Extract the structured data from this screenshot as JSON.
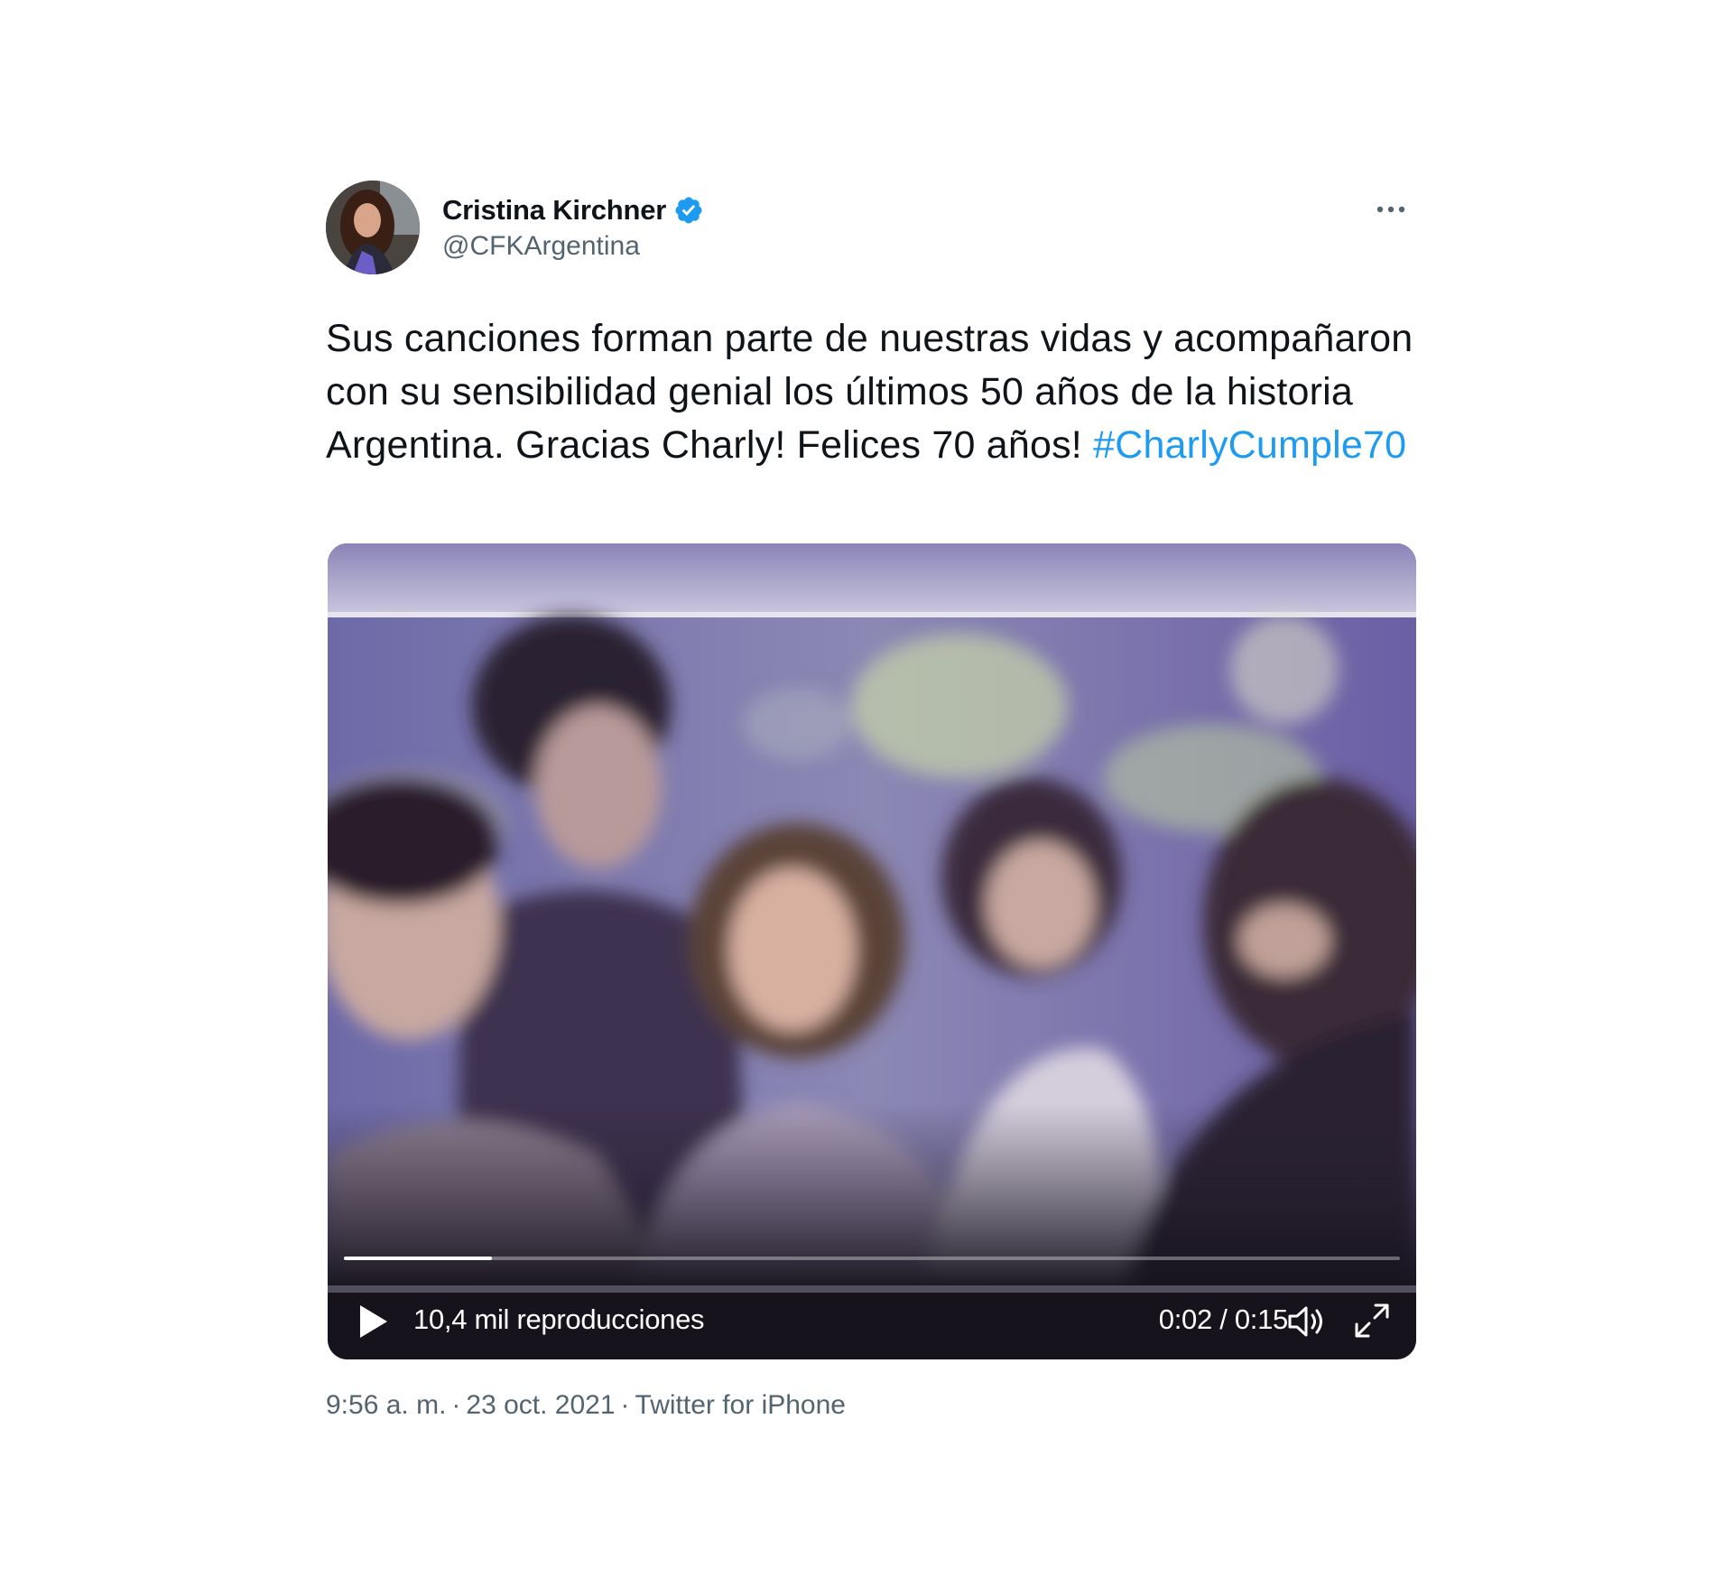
{
  "tweet": {
    "author": {
      "display_name": "Cristina Kirchner",
      "handle": "@CFKArgentina",
      "verified": true
    },
    "text": "Sus canciones forman parte de nuestras vidas y acompañaron con su sensibilidad genial los últimos 50 años de la historia Argentina. Gracias Charly! Felices 70 años! ",
    "hashtag": "#CharlyCumple70",
    "video": {
      "views": "10,4 mil reproducciones",
      "time": "0:02 / 0:15",
      "progress_fraction": 0.14
    },
    "meta": {
      "time": "9:56 a. m.",
      "separator": "·",
      "date": "23 oct. 2021",
      "source": "Twitter for iPhone"
    }
  },
  "colors": {
    "link": "#1d9bf0",
    "secondary_text": "#536471",
    "primary_text": "#0f1419"
  },
  "icons": {
    "verified": "verified-badge-icon",
    "more": "more-dots-icon",
    "play": "play-icon",
    "volume": "volume-icon",
    "fullscreen": "fullscreen-icon"
  }
}
